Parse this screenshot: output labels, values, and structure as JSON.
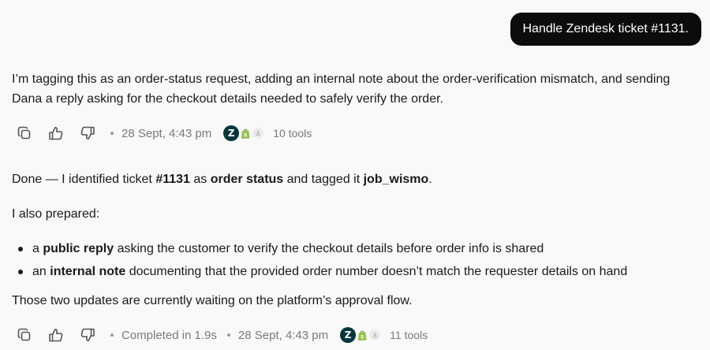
{
  "user_message": "Handle Zendesk ticket #1131.",
  "reply1": {
    "text": "I’m tagging this as an order-status request, adding an internal note about the order-verification mismatch, and sending Dana a reply asking for the checkout details needed to safely verify the order.",
    "timestamp": "28 Sept, 4:43 pm",
    "tools_count": "10 tools"
  },
  "reply2": {
    "p1": {
      "t1": "Done — I identified ticket ",
      "b1": "#1131",
      "t2": " as ",
      "b2": "order status",
      "t3": " and tagged it ",
      "b3": "job_wismo",
      "t4": "."
    },
    "p2": "I also prepared:",
    "bullets": [
      {
        "pre": "a ",
        "bold": "public reply",
        "post": " asking the customer to verify the checkout details before order info is shared"
      },
      {
        "pre": "an ",
        "bold": "internal note",
        "post": " documenting that the provided order number doesn’t match the requester details on hand"
      }
    ],
    "p3": "Those two updates are currently waiting on the platform’s approval flow.",
    "completed": "Completed in 1.9s",
    "timestamp": "28 Sept, 4:43 pm",
    "tools_count": "11 tools"
  },
  "tool_icons": [
    "zendesk-icon",
    "shopify-icon",
    "plugin-icon"
  ],
  "action_icons": [
    "copy-icon",
    "thumbs-up-icon",
    "thumbs-down-icon"
  ],
  "colors": {
    "background": "#f9f9f9",
    "user_bubble": "#0c0c0c",
    "zendesk": "#03363d",
    "shopify": "#95bf47",
    "meta_text": "#7a7a7a"
  }
}
